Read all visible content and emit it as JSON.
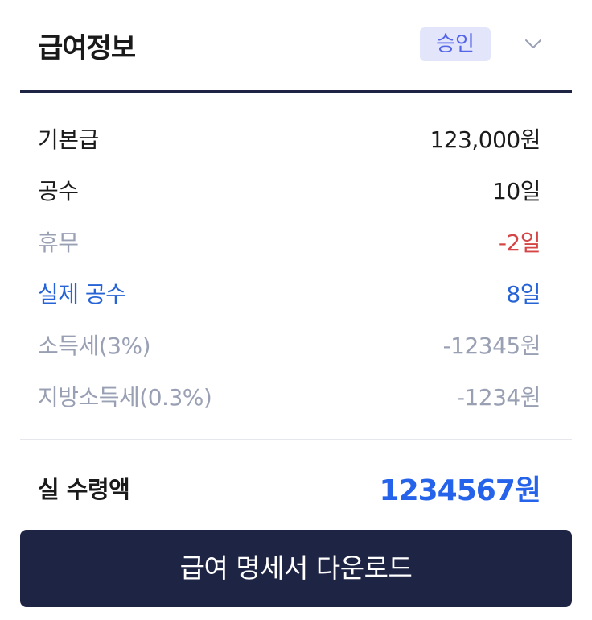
{
  "header": {
    "title": "급여정보",
    "status_badge": "승인",
    "toggle_icon": "chevron-down-icon"
  },
  "rows": [
    {
      "label": "기본급",
      "value": "123,000원",
      "tone": "dark"
    },
    {
      "label": "공수",
      "value": "10일",
      "tone": "dark"
    },
    {
      "label": "휴무",
      "value": "-2일",
      "tone": "muted-red"
    },
    {
      "label": "실제 공수",
      "value": "8일",
      "tone": "blue"
    },
    {
      "label": "소득세(3%)",
      "value": "-12345원",
      "tone": "muted"
    },
    {
      "label": "지방소득세(0.3%)",
      "value": "-1234원",
      "tone": "muted"
    }
  ],
  "total": {
    "label": "실 수령액",
    "value": "1234567원"
  },
  "download_button": {
    "label": "급여 명세서 다운로드"
  },
  "colors": {
    "navy": "#1e2444",
    "badge_bg": "#e3e5fb",
    "badge_text": "#5565e8",
    "blue": "#2563eb",
    "red": "#d64545",
    "muted": "#9aa0b4"
  }
}
